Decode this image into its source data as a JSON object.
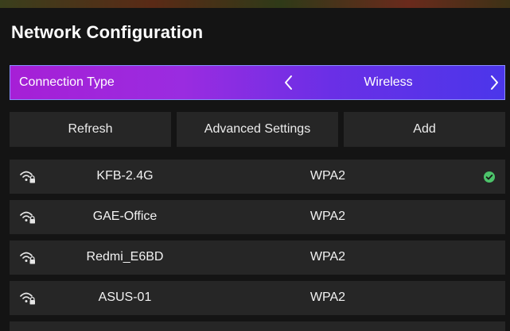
{
  "page": {
    "title": "Network Configuration"
  },
  "connection": {
    "label": "Connection Type",
    "value": "Wireless",
    "prev_icon": "chevron-left-icon",
    "next_icon": "chevron-right-icon"
  },
  "actions": {
    "refresh_label": "Refresh",
    "advanced_label": "Advanced Settings",
    "add_label": "Add"
  },
  "networks": [
    {
      "ssid": "KFB-2.4G",
      "security": "WPA2",
      "connected": true
    },
    {
      "ssid": "GAE-Office",
      "security": "WPA2",
      "connected": false
    },
    {
      "ssid": "Redmi_E6BD",
      "security": "WPA2",
      "connected": false
    },
    {
      "ssid": "ASUS-01",
      "security": "WPA2",
      "connected": false
    }
  ],
  "icons": {
    "network": "wifi-lock-icon",
    "connected": "check-circle-icon"
  },
  "colors": {
    "background": "#141414",
    "row": "#262626",
    "accent_gradient_start": "#a61fd6",
    "accent_gradient_end": "#4b36ea",
    "connected_green": "#4cc36a"
  }
}
